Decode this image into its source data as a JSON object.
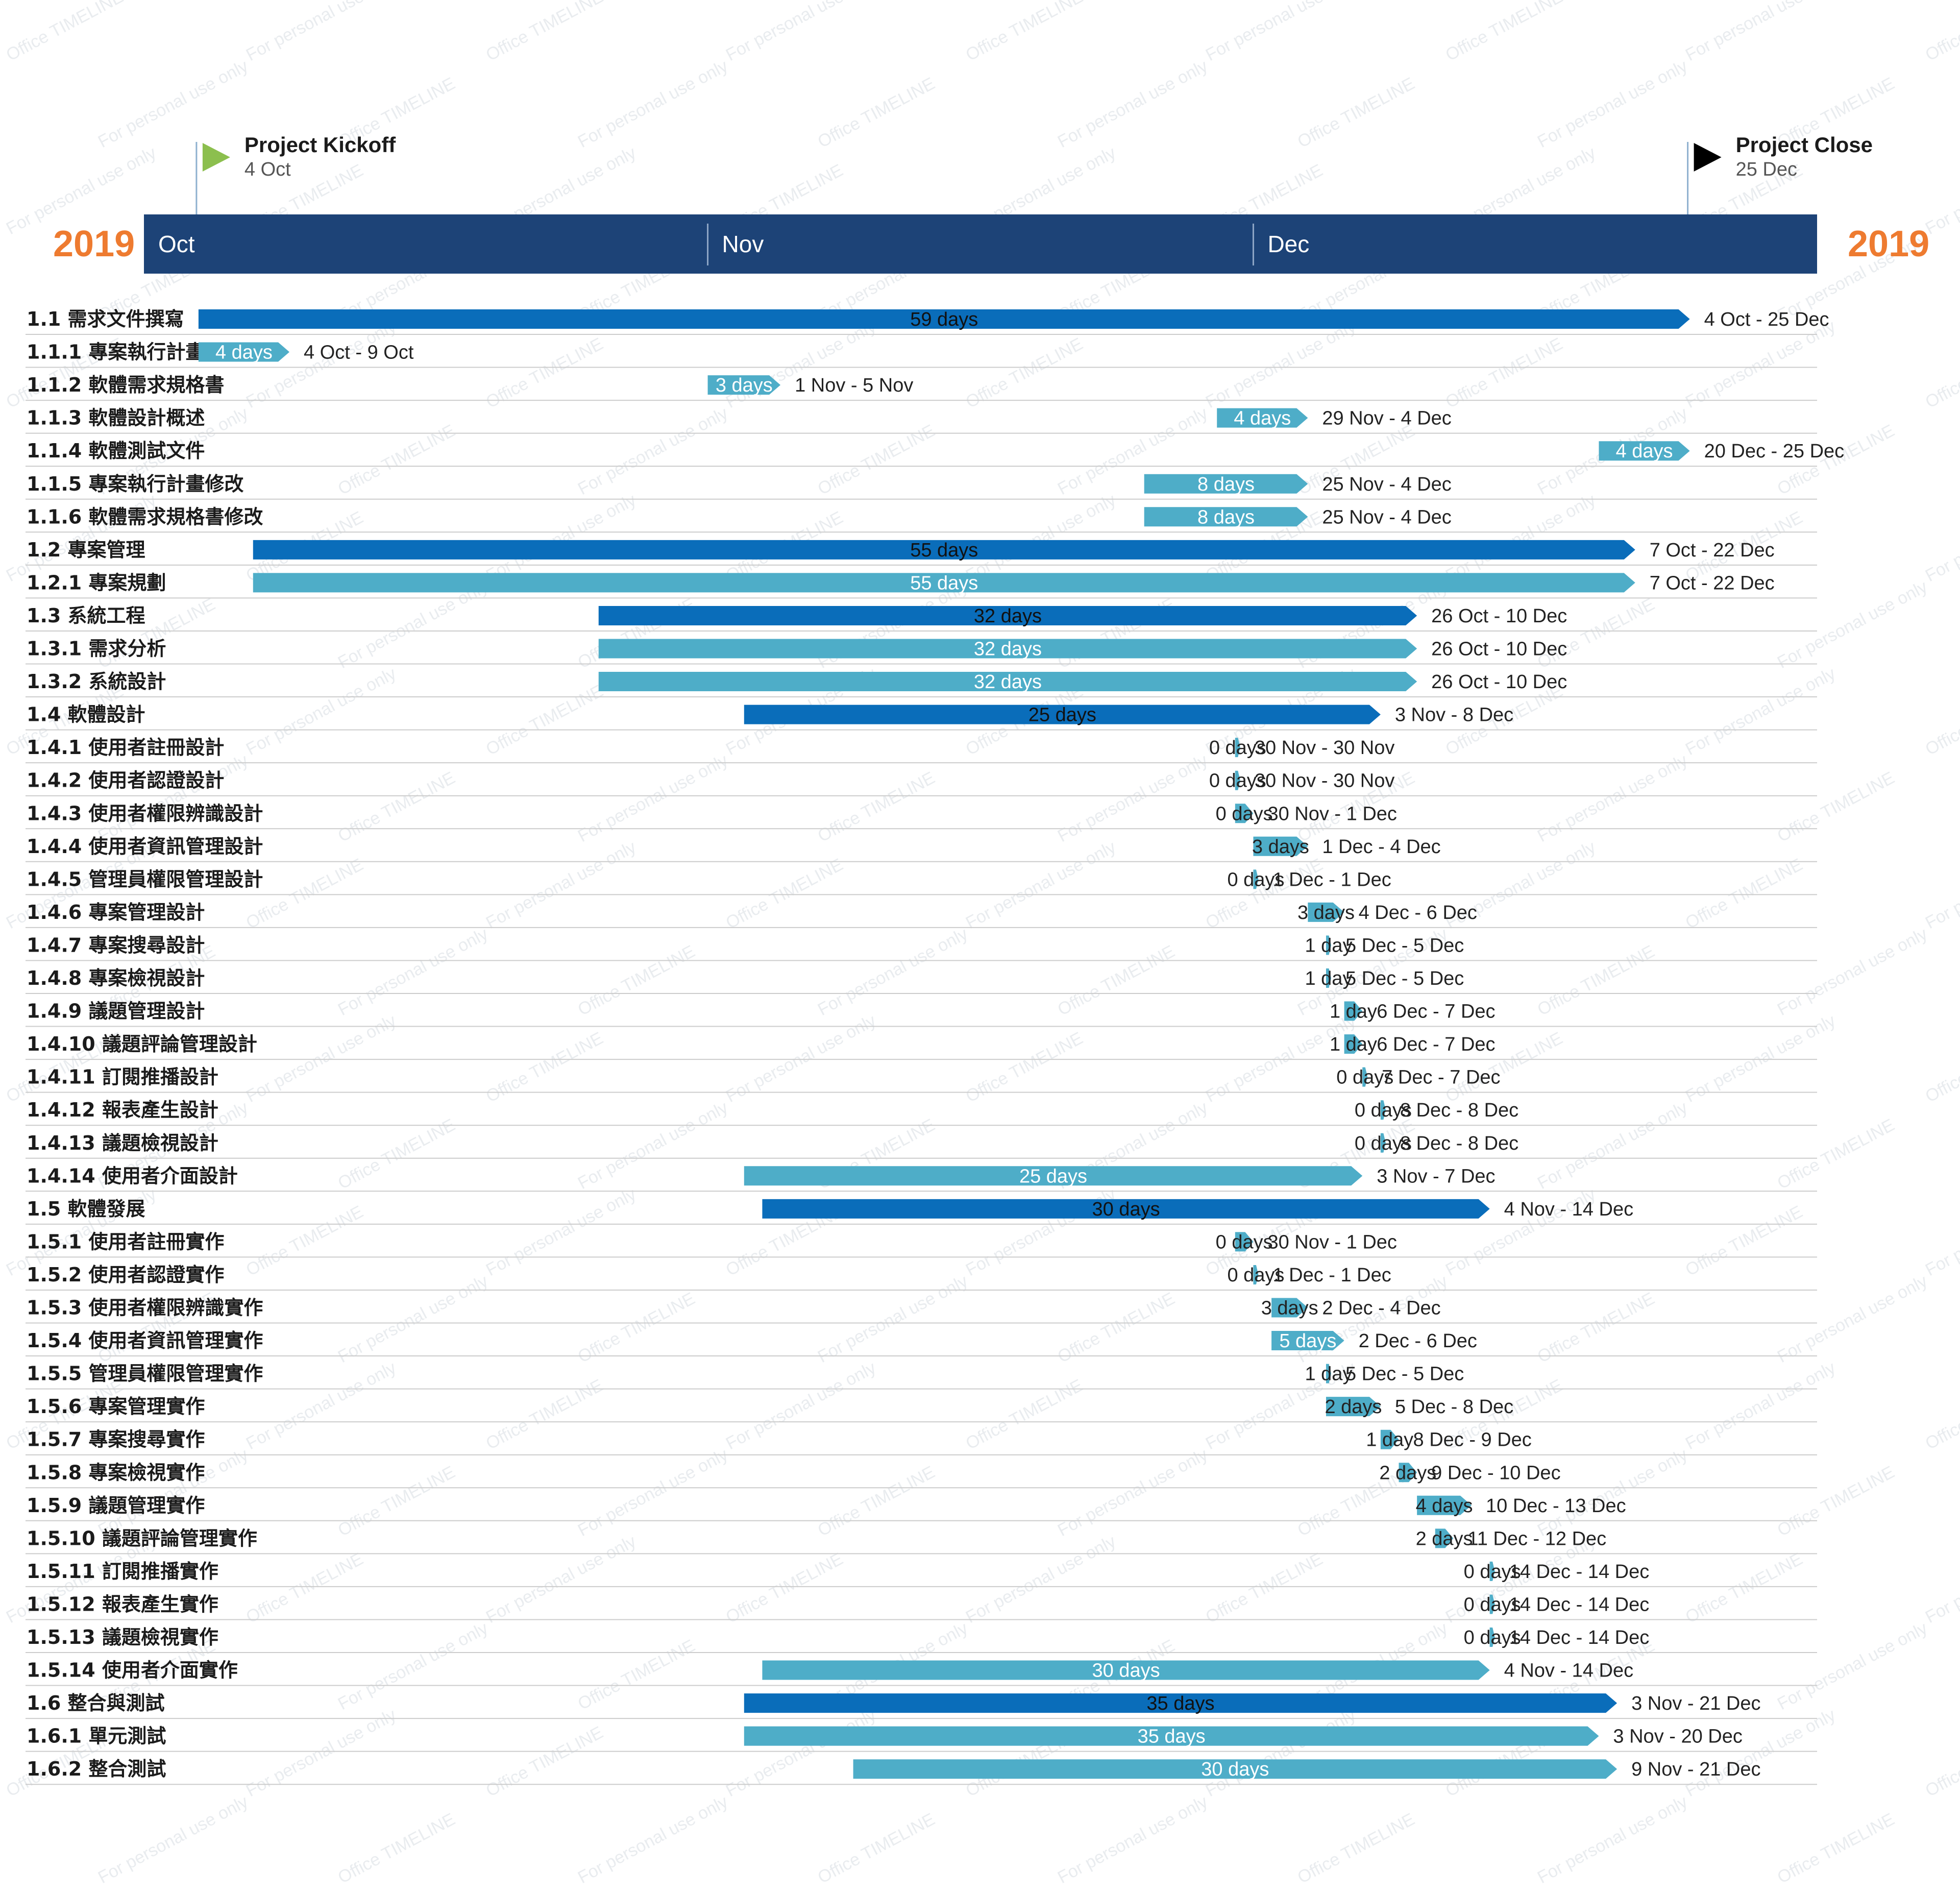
{
  "colors": {
    "header_bg": "#1d4377",
    "parent_bar": "#0a6dba",
    "child_bar": "#4eadc8",
    "year_text": "#ee7b30",
    "row_line": "#cccccc",
    "kickoff_flag": "#8cbf4e",
    "close_flag": "#000000",
    "watermark": "#e9ecef"
  },
  "watermarks": [
    "Office TIMELINE",
    "For personal use only"
  ],
  "chart_data": {
    "type": "gantt",
    "timescale": {
      "start": "2019-10-01",
      "end": "2019-12-31",
      "year_left": "2019",
      "year_right": "2019",
      "months": [
        {
          "label": "Oct",
          "start": "2019-10-01"
        },
        {
          "label": "Nov",
          "start": "2019-11-01"
        },
        {
          "label": "Dec",
          "start": "2019-12-01"
        }
      ]
    },
    "milestones": [
      {
        "name": "Project Kickoff",
        "date_label": "4 Oct",
        "date": "2019-10-04",
        "icon": "flag-icon"
      },
      {
        "name": "Project Close",
        "date_label": "25 Dec",
        "date": "2019-12-25",
        "icon": "flag-icon"
      }
    ],
    "tasks": [
      {
        "label": "1.1 需求文件撰寫",
        "start": "2019-10-04",
        "end": "2019-12-25",
        "duration": "59 days",
        "range": "4 Oct - 25 Dec",
        "level": "parent"
      },
      {
        "label": "1.1.1 專案執行計畫",
        "start": "2019-10-04",
        "end": "2019-10-09",
        "duration": "4 days",
        "range": "4 Oct - 9 Oct",
        "level": "child"
      },
      {
        "label": "1.1.2 軟體需求規格書",
        "start": "2019-11-01",
        "end": "2019-11-05",
        "duration": "3 days",
        "range": "1 Nov - 5 Nov",
        "level": "child"
      },
      {
        "label": "1.1.3 軟體設計概述",
        "start": "2019-11-29",
        "end": "2019-12-04",
        "duration": "4 days",
        "range": "29 Nov - 4 Dec",
        "level": "child"
      },
      {
        "label": "1.1.4 軟體測試文件",
        "start": "2019-12-20",
        "end": "2019-12-25",
        "duration": "4 days",
        "range": "20 Dec - 25 Dec",
        "level": "child"
      },
      {
        "label": "1.1.5 專案執行計畫修改",
        "start": "2019-11-25",
        "end": "2019-12-04",
        "duration": "8 days",
        "range": "25 Nov - 4 Dec",
        "level": "child"
      },
      {
        "label": "1.1.6 軟體需求規格書修改",
        "start": "2019-11-25",
        "end": "2019-12-04",
        "duration": "8 days",
        "range": "25 Nov - 4 Dec",
        "level": "child"
      },
      {
        "label": "1.2 專案管理",
        "start": "2019-10-07",
        "end": "2019-12-22",
        "duration": "55 days",
        "range": "7 Oct - 22 Dec",
        "level": "parent"
      },
      {
        "label": "1.2.1 專案規劃",
        "start": "2019-10-07",
        "end": "2019-12-22",
        "duration": "55 days",
        "range": "7 Oct - 22 Dec",
        "level": "child"
      },
      {
        "label": "1.3 系統工程",
        "start": "2019-10-26",
        "end": "2019-12-10",
        "duration": "32 days",
        "range": "26 Oct - 10 Dec",
        "level": "parent"
      },
      {
        "label": "1.3.1 需求分析",
        "start": "2019-10-26",
        "end": "2019-12-10",
        "duration": "32 days",
        "range": "26 Oct - 10 Dec",
        "level": "child"
      },
      {
        "label": "1.3.2 系統設計",
        "start": "2019-10-26",
        "end": "2019-12-10",
        "duration": "32 days",
        "range": "26 Oct - 10 Dec",
        "level": "child"
      },
      {
        "label": "1.4 軟體設計",
        "start": "2019-11-03",
        "end": "2019-12-08",
        "duration": "25 days",
        "range": "3 Nov - 8 Dec",
        "level": "parent"
      },
      {
        "label": "1.4.1 使用者註冊設計",
        "start": "2019-11-30",
        "end": "2019-11-30",
        "duration": "0 days",
        "range": "30 Nov - 30 Nov",
        "level": "child"
      },
      {
        "label": "1.4.2 使用者認證設計",
        "start": "2019-11-30",
        "end": "2019-11-30",
        "duration": "0 days",
        "range": "30 Nov - 30 Nov",
        "level": "child"
      },
      {
        "label": "1.4.3 使用者權限辨識設計",
        "start": "2019-11-30",
        "end": "2019-12-01",
        "duration": "0 days",
        "range": "30 Nov - 1 Dec",
        "level": "child"
      },
      {
        "label": "1.4.4 使用者資訊管理設計",
        "start": "2019-12-01",
        "end": "2019-12-04",
        "duration": "3 days",
        "range": "1 Dec - 4 Dec",
        "level": "child"
      },
      {
        "label": "1.4.5 管理員權限管理設計",
        "start": "2019-12-01",
        "end": "2019-12-01",
        "duration": "0 days",
        "range": "1 Dec - 1 Dec",
        "level": "child"
      },
      {
        "label": "1.4.6 專案管理設計",
        "start": "2019-12-04",
        "end": "2019-12-06",
        "duration": "3 days",
        "range": "4 Dec - 6 Dec",
        "level": "child"
      },
      {
        "label": "1.4.7 專案搜尋設計",
        "start": "2019-12-05",
        "end": "2019-12-05",
        "duration": "1 day",
        "range": "5 Dec - 5 Dec",
        "level": "child"
      },
      {
        "label": "1.4.8 專案檢視設計",
        "start": "2019-12-05",
        "end": "2019-12-05",
        "duration": "1 day",
        "range": "5 Dec - 5 Dec",
        "level": "child"
      },
      {
        "label": "1.4.9 議題管理設計",
        "start": "2019-12-06",
        "end": "2019-12-07",
        "duration": "1 day",
        "range": "6 Dec - 7 Dec",
        "level": "child"
      },
      {
        "label": "1.4.10 議題評論管理設計",
        "start": "2019-12-06",
        "end": "2019-12-07",
        "duration": "1 day",
        "range": "6 Dec - 7 Dec",
        "level": "child"
      },
      {
        "label": "1.4.11 訂閱推播設計",
        "start": "2019-12-07",
        "end": "2019-12-07",
        "duration": "0 days",
        "range": "7 Dec - 7 Dec",
        "level": "child"
      },
      {
        "label": "1.4.12 報表產生設計",
        "start": "2019-12-08",
        "end": "2019-12-08",
        "duration": "0 days",
        "range": "8 Dec - 8 Dec",
        "level": "child"
      },
      {
        "label": "1.4.13 議題檢視設計",
        "start": "2019-12-08",
        "end": "2019-12-08",
        "duration": "0 days",
        "range": "8 Dec - 8 Dec",
        "level": "child"
      },
      {
        "label": "1.4.14 使用者介面設計",
        "start": "2019-11-03",
        "end": "2019-12-07",
        "duration": "25 days",
        "range": "3 Nov - 7 Dec",
        "level": "child"
      },
      {
        "label": "1.5 軟體發展",
        "start": "2019-11-04",
        "end": "2019-12-14",
        "duration": "30 days",
        "range": "4 Nov - 14 Dec",
        "level": "parent"
      },
      {
        "label": "1.5.1 使用者註冊實作",
        "start": "2019-11-30",
        "end": "2019-12-01",
        "duration": "0 days",
        "range": "30 Nov - 1 Dec",
        "level": "child"
      },
      {
        "label": "1.5.2 使用者認證實作",
        "start": "2019-12-01",
        "end": "2019-12-01",
        "duration": "0 days",
        "range": "1 Dec - 1 Dec",
        "level": "child"
      },
      {
        "label": "1.5.3 使用者權限辨識實作",
        "start": "2019-12-02",
        "end": "2019-12-04",
        "duration": "3 days",
        "range": "2 Dec - 4 Dec",
        "level": "child"
      },
      {
        "label": "1.5.4 使用者資訊管理實作",
        "start": "2019-12-02",
        "end": "2019-12-06",
        "duration": "5 days",
        "range": "2 Dec - 6 Dec",
        "level": "child"
      },
      {
        "label": "1.5.5 管理員權限管理實作",
        "start": "2019-12-05",
        "end": "2019-12-05",
        "duration": "1 day",
        "range": "5 Dec - 5 Dec",
        "level": "child"
      },
      {
        "label": "1.5.6 專案管理實作",
        "start": "2019-12-05",
        "end": "2019-12-08",
        "duration": "2 days",
        "range": "5 Dec - 8 Dec",
        "level": "child"
      },
      {
        "label": "1.5.7 專案搜尋實作",
        "start": "2019-12-08",
        "end": "2019-12-09",
        "duration": "1 day",
        "range": "8 Dec - 9 Dec",
        "level": "child"
      },
      {
        "label": "1.5.8 專案檢視實作",
        "start": "2019-12-09",
        "end": "2019-12-10",
        "duration": "2 days",
        "range": "9 Dec - 10 Dec",
        "level": "child"
      },
      {
        "label": "1.5.9 議題管理實作",
        "start": "2019-12-10",
        "end": "2019-12-13",
        "duration": "4 days",
        "range": "10 Dec - 13 Dec",
        "level": "child"
      },
      {
        "label": "1.5.10 議題評論管理實作",
        "start": "2019-12-11",
        "end": "2019-12-12",
        "duration": "2 days",
        "range": "11 Dec - 12 Dec",
        "level": "child"
      },
      {
        "label": "1.5.11 訂閱推播實作",
        "start": "2019-12-14",
        "end": "2019-12-14",
        "duration": "0 days",
        "range": "14 Dec - 14 Dec",
        "level": "child"
      },
      {
        "label": "1.5.12 報表產生實作",
        "start": "2019-12-14",
        "end": "2019-12-14",
        "duration": "0 days",
        "range": "14 Dec - 14 Dec",
        "level": "child"
      },
      {
        "label": "1.5.13 議題檢視實作",
        "start": "2019-12-14",
        "end": "2019-12-14",
        "duration": "0 days",
        "range": "14 Dec - 14 Dec",
        "level": "child"
      },
      {
        "label": "1.5.14 使用者介面實作",
        "start": "2019-11-04",
        "end": "2019-12-14",
        "duration": "30 days",
        "range": "4 Nov - 14 Dec",
        "level": "child"
      },
      {
        "label": "1.6 整合與測試",
        "start": "2019-11-03",
        "end": "2019-12-21",
        "duration": "35 days",
        "range": "3 Nov - 21 Dec",
        "level": "parent"
      },
      {
        "label": "1.6.1 單元測試",
        "start": "2019-11-03",
        "end": "2019-12-20",
        "duration": "35 days",
        "range": "3 Nov - 20 Dec",
        "level": "child"
      },
      {
        "label": "1.6.2 整合測試",
        "start": "2019-11-09",
        "end": "2019-12-21",
        "duration": "30 days",
        "range": "9 Nov - 21 Dec",
        "level": "child"
      }
    ]
  }
}
